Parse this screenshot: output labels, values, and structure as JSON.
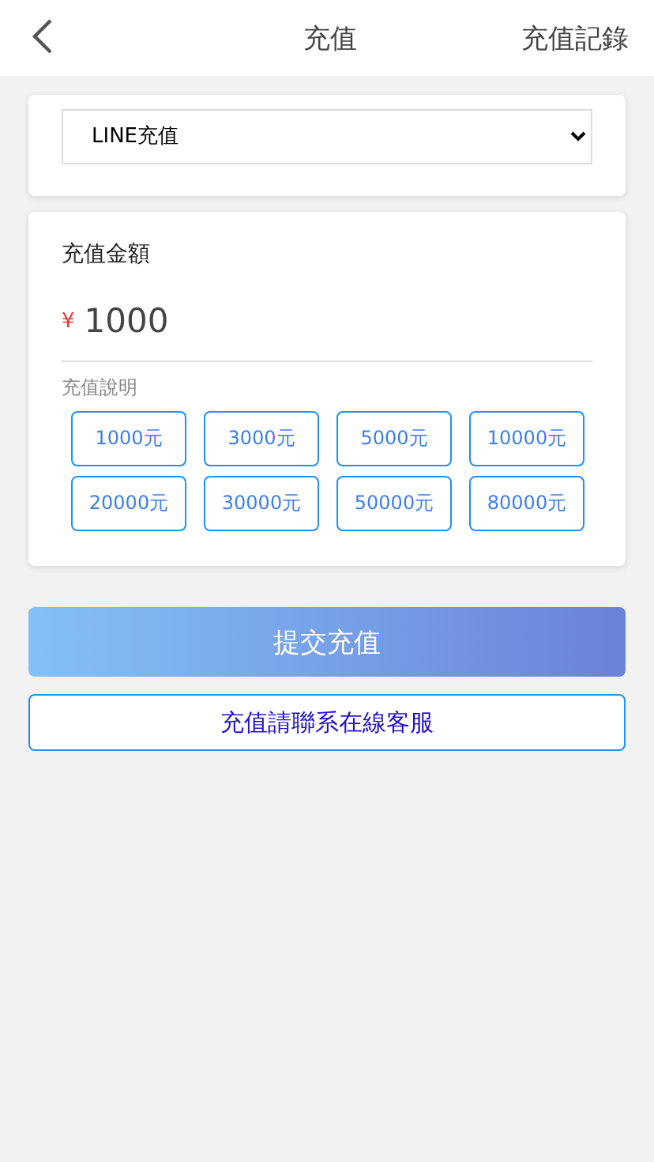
{
  "header": {
    "title": "充值",
    "link": "充值記錄"
  },
  "channel_select": {
    "value": "LINE充值"
  },
  "amount": {
    "label": "充值金額",
    "currency": "¥",
    "value": "1000",
    "note": "充值說明",
    "options": [
      "1000元",
      "3000元",
      "5000元",
      "10000元",
      "20000元",
      "30000元",
      "50000元",
      "80000元"
    ]
  },
  "submit_button": "提交充值",
  "contact_button": "充值請聯系在線客服"
}
